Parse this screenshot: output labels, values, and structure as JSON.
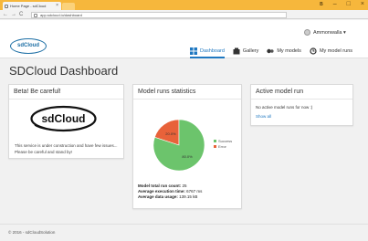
{
  "browser": {
    "tab_title": "Home Page - sdCloud",
    "tab_close": "×",
    "url": "app.sdcloud.io/dashboard",
    "window_controls": [
      "B",
      "–",
      "□",
      "×"
    ],
    "nav_icons": [
      "←",
      "→",
      "C",
      "⌂"
    ],
    "extension_colors": [
      "#c9a227",
      "#4a7dbf",
      "#3a9a3a",
      "#d9534f",
      "#888888"
    ]
  },
  "header": {
    "logo_text": "sdCloud",
    "user_name": "Ammonwalla ▾",
    "nav": [
      {
        "label": "Dashboard",
        "icon": "dashboard-icon",
        "active": true
      },
      {
        "label": "Gallery",
        "icon": "gallery-icon",
        "active": false
      },
      {
        "label": "My models",
        "icon": "models-icon",
        "active": false
      },
      {
        "label": "My model runs",
        "icon": "history-icon",
        "active": false
      }
    ]
  },
  "page": {
    "title": "SDCloud Dashboard"
  },
  "beta_card": {
    "title": "Beta! Be careful!",
    "logo_text": "sdCloud",
    "message": "This service is under construction and have few issues... Please be careful and stand by!"
  },
  "stats_card": {
    "title": "Model runs statistics",
    "total_label": "Model total run count:",
    "total_value": "25",
    "avg_time_label": "Average execution time:",
    "avg_time_value": "6767 ms",
    "avg_data_label": "Average data usage:",
    "avg_data_value": "139.15 kB"
  },
  "chart_data": {
    "type": "pie",
    "series": [
      {
        "name": "Success",
        "value": 80.0,
        "label": "80.0%",
        "color": "#6cc46c"
      },
      {
        "name": "Error",
        "value": 20.0,
        "label": "20.0%",
        "color": "#e8623a"
      }
    ]
  },
  "active_card": {
    "title": "Active model run",
    "empty_text": "No active model runs for now :)",
    "show_all": "Show all"
  },
  "footer": {
    "text": "© 2016 - sdCloudSolution"
  },
  "colors": {
    "accent": "#1f78c1",
    "browser_bar": "#f6b73c"
  }
}
